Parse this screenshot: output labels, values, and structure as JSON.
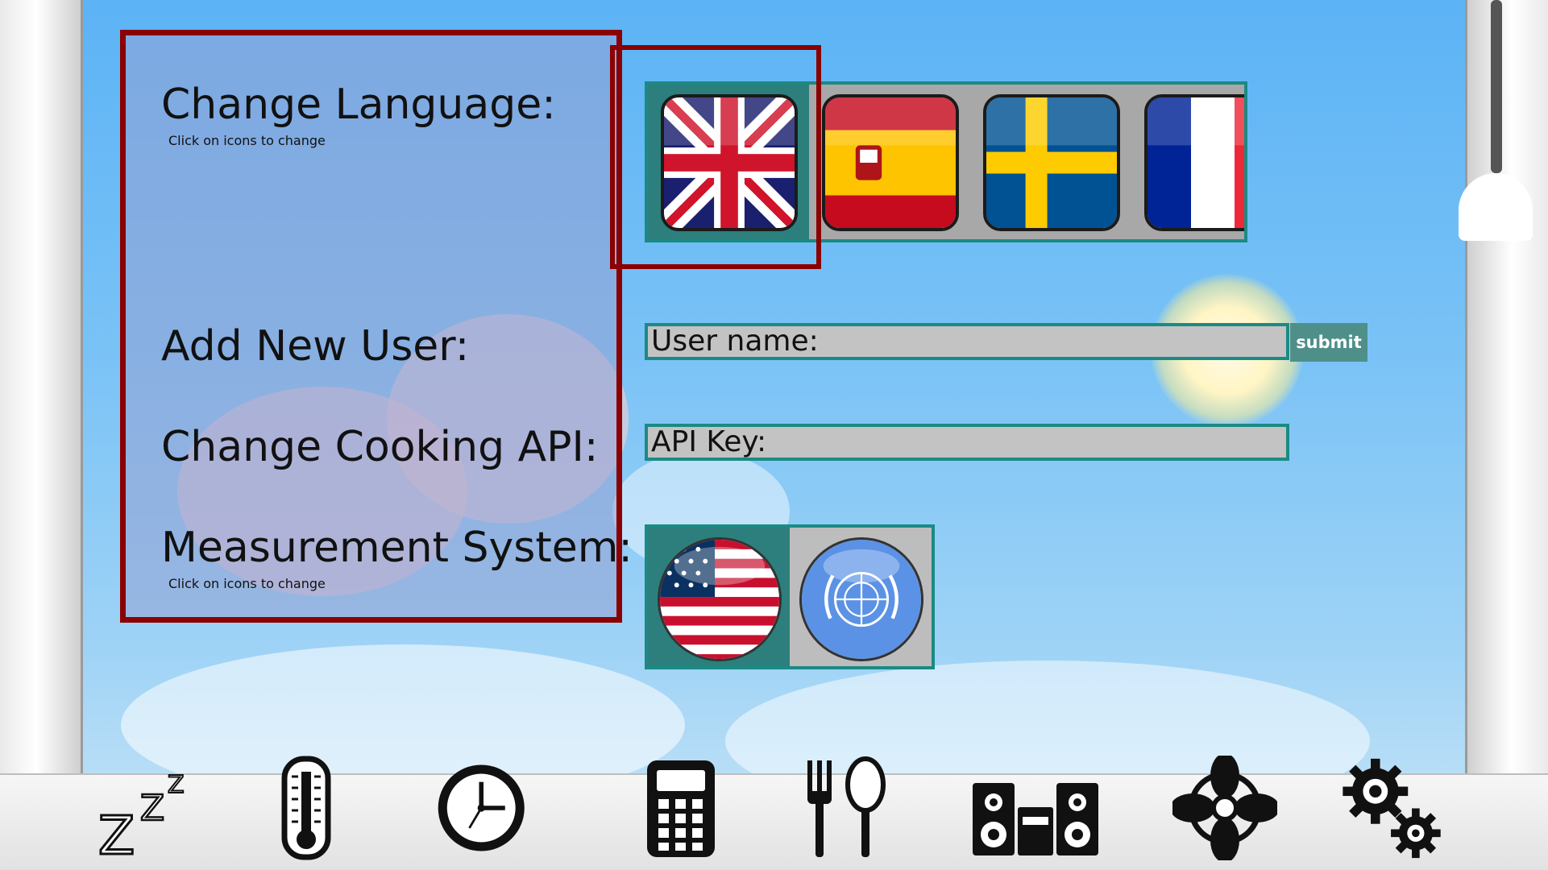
{
  "settings": {
    "language": {
      "heading": "Change Language:",
      "hint": "Click on icons to change",
      "flags": [
        {
          "name": "united-kingdom",
          "selected": true
        },
        {
          "name": "spain",
          "selected": false
        },
        {
          "name": "sweden",
          "selected": false
        },
        {
          "name": "france",
          "selected": false
        }
      ]
    },
    "user": {
      "heading": "Add New User:",
      "field_value": "User name:",
      "submit_label": "submit"
    },
    "api": {
      "heading": "Change Cooking API:",
      "field_value": "API Key:"
    },
    "measurement": {
      "heading": "Measurement System:",
      "hint": "Click on icons to change",
      "options": [
        {
          "name": "imperial-us",
          "selected": true
        },
        {
          "name": "metric-un",
          "selected": false
        }
      ]
    }
  },
  "bottom_nav": {
    "items": [
      {
        "name": "sleep",
        "label": "Z"
      },
      {
        "name": "temperature"
      },
      {
        "name": "clock"
      },
      {
        "name": "calculator"
      },
      {
        "name": "cooking"
      },
      {
        "name": "music"
      },
      {
        "name": "fan"
      },
      {
        "name": "settings"
      }
    ]
  },
  "colors": {
    "panel_border": "#8b0000",
    "field_border": "#1b8a84",
    "selected_bg": "#2c7f7c",
    "submit_bg": "#4f8f8a"
  }
}
